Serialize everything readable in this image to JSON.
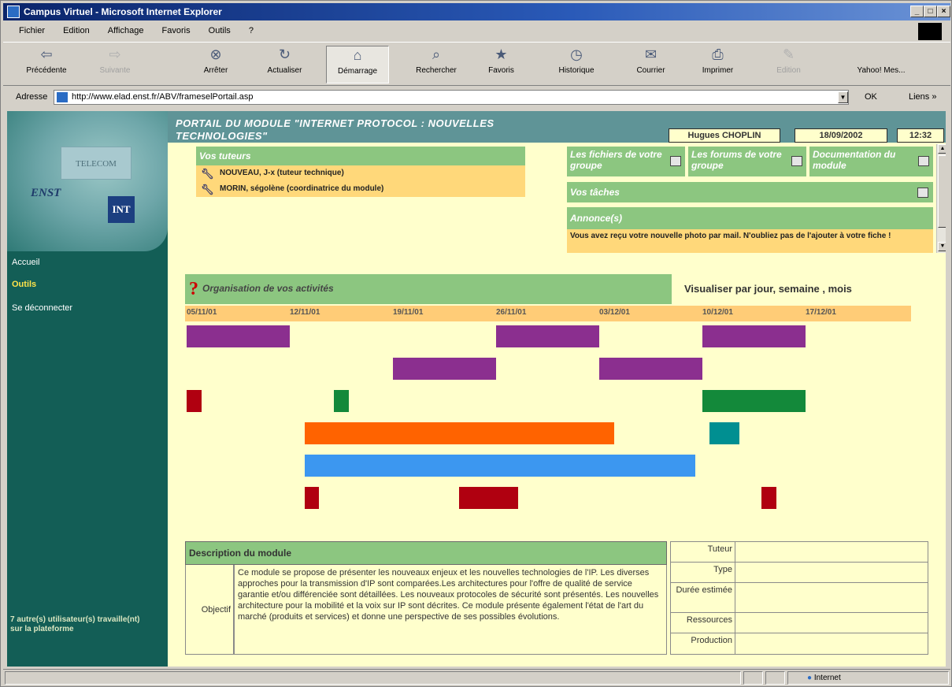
{
  "window": {
    "title": "Campus Virtuel - Microsoft Internet Explorer",
    "controls": {
      "minimize": "_",
      "maximize": "□",
      "close": "×"
    }
  },
  "menu": [
    "Fichier",
    "Edition",
    "Affichage",
    "Favoris",
    "Outils",
    "?"
  ],
  "toolbar": [
    {
      "label": "Précédente",
      "icon": "back-arrow-icon",
      "glyph": "⇦",
      "enabled": true
    },
    {
      "label": "Suivante",
      "icon": "forward-arrow-icon",
      "glyph": "⇨",
      "enabled": false
    },
    {
      "label": "Arrêter",
      "icon": "stop-icon",
      "glyph": "⊗",
      "enabled": true
    },
    {
      "label": "Actualiser",
      "icon": "refresh-icon",
      "glyph": "↻",
      "enabled": true
    },
    {
      "label": "Démarrage",
      "icon": "home-icon",
      "glyph": "⌂",
      "enabled": true,
      "pressed": true
    },
    {
      "label": "Rechercher",
      "icon": "search-icon",
      "glyph": "⌕",
      "enabled": true
    },
    {
      "label": "Favoris",
      "icon": "favorites-icon",
      "glyph": "★",
      "enabled": true
    },
    {
      "label": "Historique",
      "icon": "history-icon",
      "glyph": "◷",
      "enabled": true
    },
    {
      "label": "Courrier",
      "icon": "mail-icon",
      "glyph": "✉",
      "enabled": true
    },
    {
      "label": "Imprimer",
      "icon": "print-icon",
      "glyph": "⎙",
      "enabled": true
    },
    {
      "label": "Edition",
      "icon": "edit-icon",
      "glyph": "✎",
      "enabled": false
    },
    {
      "label": "Yahoo! Mes...",
      "icon": "yahoo-icon",
      "glyph": "",
      "enabled": true
    }
  ],
  "address": {
    "label": "Adresse",
    "url": "http://www.elad.enst.fr/ABV/frameselPortail.asp",
    "go": "OK",
    "links": "Liens »"
  },
  "sidebar": {
    "logo_text": "TELECOM",
    "logo_enst": "ENST",
    "logo_int": "INT",
    "nav": [
      {
        "label": "Accueil",
        "active": false
      },
      {
        "label": "Outils",
        "active": true
      },
      {
        "label": "Se déconnecter",
        "active": false
      }
    ],
    "others": "7 autre(s) utilisateur(s) travaille(nt) sur la plateforme"
  },
  "header": {
    "portal_title": "PORTAIL DU MODULE \"INTERNET PROTOCOL : NOUVELLES TECHNOLOGIES\"",
    "user": "Hugues CHOPLIN",
    "date": "18/09/2002",
    "time": "12:32"
  },
  "tutors": {
    "title": "Vos tuteurs",
    "items": [
      "NOUVEAU, J-x (tuteur technique)",
      "MORIN, ségolène (coordinatrice du module)"
    ]
  },
  "tiles": [
    {
      "label": "Les fichiers de votre groupe"
    },
    {
      "label": "Les forums de votre groupe"
    },
    {
      "label": "Documentation du module"
    }
  ],
  "tasks": {
    "label": "Vos tâches"
  },
  "announcement": {
    "title": "Annonce(s)",
    "text": "Vous avez reçu votre nouvelle photo par mail. N'oubliez pas de l'ajouter à votre fiche !"
  },
  "gantt": {
    "title": "Organisation de vos activités",
    "question_mark": "?",
    "view_label": "Visualiser par jour, semaine , mois",
    "weeks": [
      "05/11/01",
      "12/11/01",
      "19/11/01",
      "26/11/01",
      "03/12/01",
      "10/12/01",
      "17/12/01"
    ],
    "rows": [
      [
        {
          "start": 0,
          "end": 7,
          "color": "#8b2f8f"
        },
        {
          "start": 21,
          "end": 28,
          "color": "#8b2f8f"
        },
        {
          "start": 35,
          "end": 42,
          "color": "#8b2f8f"
        }
      ],
      [
        {
          "start": 14,
          "end": 21,
          "color": "#8b2f8f"
        },
        {
          "start": 28,
          "end": 35,
          "color": "#8b2f8f"
        }
      ],
      [
        {
          "start": 0,
          "end": 1,
          "color": "#b00010"
        },
        {
          "start": 10,
          "end": 11,
          "color": "#13893a"
        },
        {
          "start": 35,
          "end": 42,
          "color": "#13893a"
        }
      ],
      [
        {
          "start": 8,
          "end": 29,
          "color": "#ff6300"
        },
        {
          "start": 35.5,
          "end": 37.5,
          "color": "#008f91"
        }
      ],
      [
        {
          "start": 8,
          "end": 34.5,
          "color": "#3c97f0"
        }
      ],
      [
        {
          "start": 8,
          "end": 9,
          "color": "#b00010"
        },
        {
          "start": 18.5,
          "end": 22.5,
          "color": "#b00010"
        },
        {
          "start": 39,
          "end": 40,
          "color": "#b00010"
        }
      ]
    ]
  },
  "description": {
    "title": "Description du module",
    "label": "Objectif",
    "text": "Ce module se propose de présenter les nouveaux enjeux et les nouvelles technologies de l'IP. Les diverses approches pour la transmission d'IP sont comparées.Les architectures pour l'offre de qualité de service garantie et/ou différenciée sont détaillées. Les nouveaux protocoles de sécurité sont présentés. Les nouvelles architecture pour la mobilité et la voix sur IP sont décrites. Ce module présente également l'état de l'art du marché (produits et services) et donne une perspective de ses possibles évolutions."
  },
  "properties": [
    {
      "label": "Tuteur",
      "value": ""
    },
    {
      "label": "Type",
      "value": ""
    },
    {
      "label": "Durée estimée",
      "value": ""
    },
    {
      "label": "Ressources",
      "value": ""
    },
    {
      "label": "Production",
      "value": ""
    }
  ],
  "status": {
    "zone": "Internet"
  }
}
